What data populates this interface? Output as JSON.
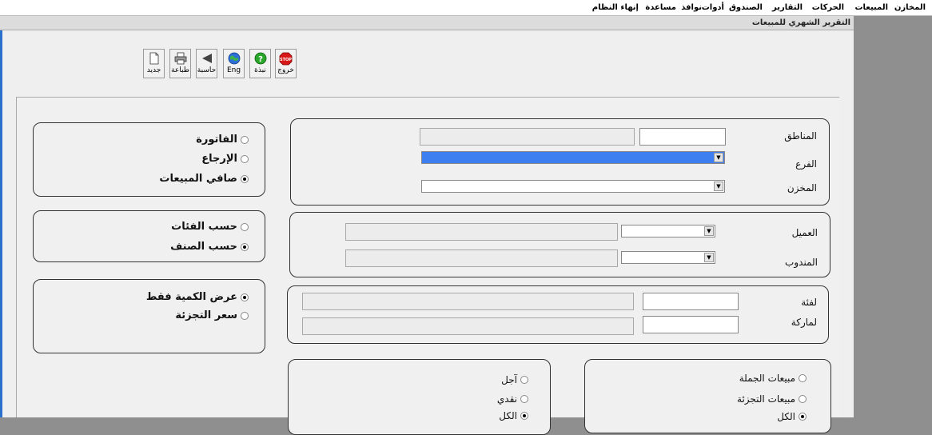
{
  "menubar": {
    "items": [
      "المخازن",
      "المبيعات",
      "الحركات",
      "التقارير",
      "الصندوق",
      "أدوات",
      "نوافذ",
      "مساعدة",
      "إنهاء النظام"
    ]
  },
  "window": {
    "title": "التقرير الشهري للمبيعات"
  },
  "toolbar": {
    "exit_label": "خروج",
    "help_label": "نبذة",
    "eng_label": "Eng",
    "calc_label": "حاسبة",
    "print_label": "طباعة",
    "new_label": "جديد",
    "icons": {
      "exit": "stop-sign-icon",
      "help": "help-icon",
      "eng": "globe-icon",
      "calc": "calculator-arrow-icon",
      "print": "printer-icon",
      "new": "new-document-icon"
    }
  },
  "report_type": {
    "options": [
      {
        "label": "الفاتورة",
        "checked": false
      },
      {
        "label": "الإرجاع",
        "checked": false
      },
      {
        "label": "صافي المبيعات",
        "checked": true
      }
    ]
  },
  "grouping": {
    "options": [
      {
        "label": "حسب الفئات",
        "checked": false
      },
      {
        "label": "حسب الصنف",
        "checked": true
      }
    ]
  },
  "display": {
    "options": [
      {
        "label": "عرض الكمية فقط",
        "checked": true
      },
      {
        "label": "سعر التجزئة",
        "checked": false
      }
    ]
  },
  "location": {
    "region_label": "المناطق",
    "branch_label": "الفرع",
    "store_label": "المخزن"
  },
  "parties": {
    "customer_label": "العميل",
    "rep_label": "المندوب"
  },
  "category": {
    "category_label": "لفئة",
    "brand_label": "لماركة"
  },
  "payment": {
    "options": [
      {
        "label": "آجل",
        "checked": false
      },
      {
        "label": "نقدي",
        "checked": false
      },
      {
        "label": "الكل",
        "checked": true
      }
    ]
  },
  "sale_type": {
    "options": [
      {
        "label": "مبيعات الجملة",
        "checked": false
      },
      {
        "label": "مبيعات التجزئة",
        "checked": false
      },
      {
        "label": "الكل",
        "checked": true
      }
    ]
  },
  "colors": {
    "selected_combo": "#3d7ef0",
    "left_strip": "#2c6fcc",
    "desktop": "#8f8f8f"
  }
}
